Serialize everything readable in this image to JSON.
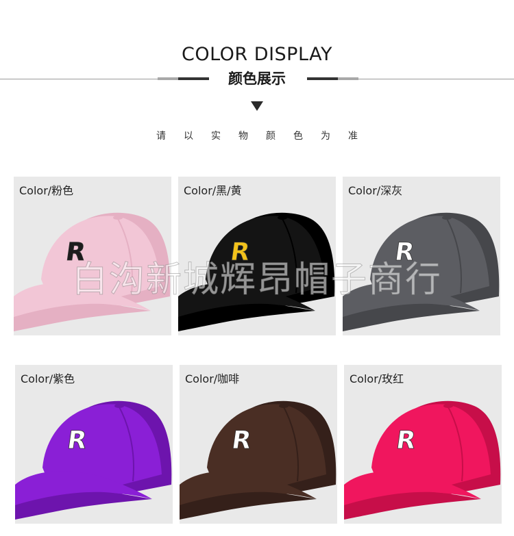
{
  "header": {
    "title": "COLOR DISPLAY",
    "subtitle": "颜色展示",
    "note": "请以实物颜色为准"
  },
  "watermark": "白沟新城辉昂帽子商行",
  "cards": [
    {
      "label": "Color/粉色",
      "cap_color": "#f2c6d6",
      "cap_shadow": "#e5b0c3",
      "logo_color": "#1c1c1c"
    },
    {
      "label": "Color/黑/黄",
      "cap_color": "#141414",
      "cap_shadow": "#000000",
      "logo_color": "#f2c21b"
    },
    {
      "label": "Color/深灰",
      "cap_color": "#5c5d62",
      "cap_shadow": "#46474b",
      "logo_color": "#ffffff"
    },
    {
      "label": "Color/紫色",
      "cap_color": "#8a1fd6",
      "cap_shadow": "#6d14ad",
      "logo_color": "#ffffff"
    },
    {
      "label": "Color/咖啡",
      "cap_color": "#4a2e24",
      "cap_shadow": "#35201a",
      "logo_color": "#ffffff"
    },
    {
      "label": "Color/玫红",
      "cap_color": "#f0165e",
      "cap_shadow": "#c70e49",
      "logo_color": "#ffffff"
    }
  ],
  "logo_letter": "R"
}
